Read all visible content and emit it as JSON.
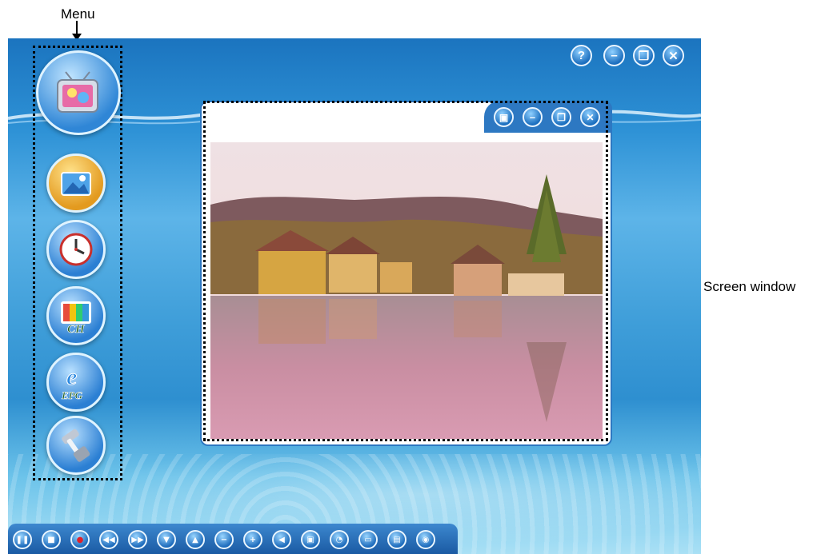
{
  "annotations": {
    "menu_label": "Menu",
    "screen_label": "Screen window"
  },
  "window_controls": [
    "help-icon",
    "minimize-icon",
    "restore-icon",
    "close-icon"
  ],
  "window_control_glyphs": [
    "?",
    "–",
    "❐",
    "✕"
  ],
  "screen_controls": [
    "fullscreen-icon",
    "minimize-icon",
    "restore-icon",
    "close-icon"
  ],
  "menu_items": [
    {
      "name": "tv-icon",
      "color": "#2f86d6"
    },
    {
      "name": "photo-icon",
      "color": "#e9a32a"
    },
    {
      "name": "clock-icon",
      "color": "#2b7fd3"
    },
    {
      "name": "channel-icon",
      "label": "CH",
      "color": "#2b7fd3"
    },
    {
      "name": "epg-icon",
      "label": "EPG",
      "color": "#2b7fd3"
    },
    {
      "name": "settings-icon",
      "color": "#2b7fd3"
    }
  ],
  "control_bar": [
    "pause-icon",
    "stop-icon",
    "record-icon",
    "rewind-icon",
    "fast-forward-icon",
    "channel-down-icon",
    "channel-up-icon",
    "volume-down-icon",
    "volume-up-icon",
    "mute-icon",
    "snapshot-icon",
    "timer-icon",
    "video-icon",
    "keyboard-icon",
    "disc-icon"
  ]
}
